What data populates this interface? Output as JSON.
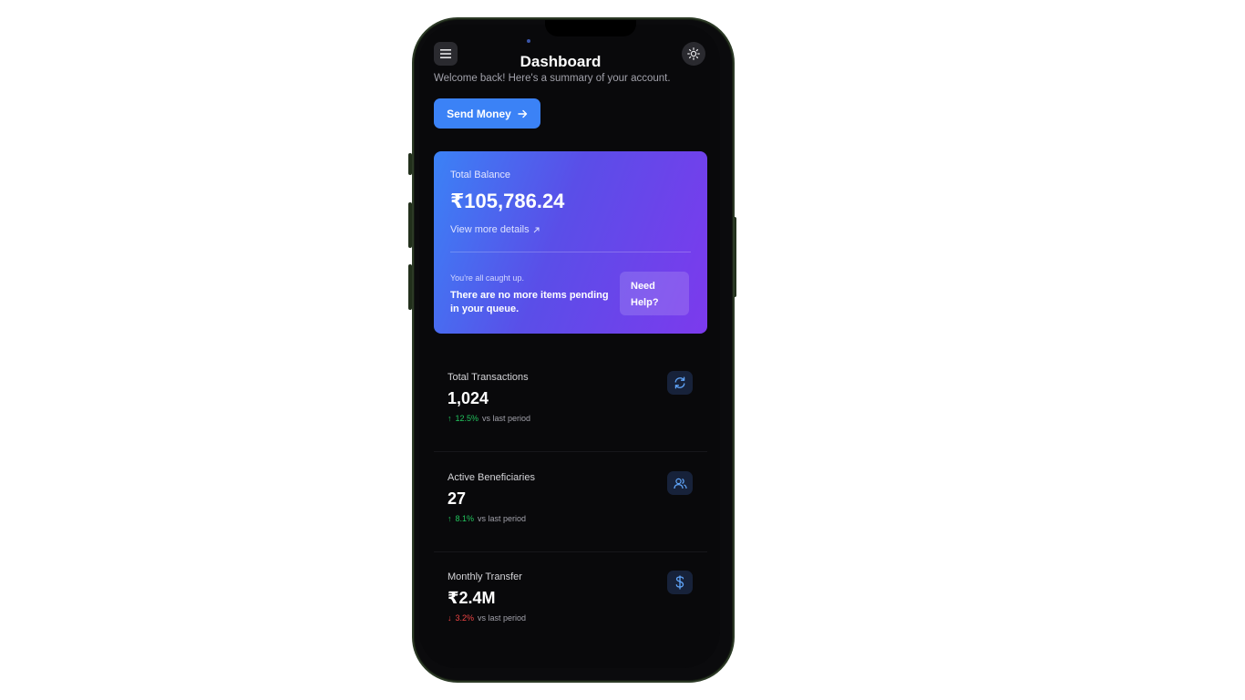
{
  "header": {
    "title": "Dashboard",
    "subtitle": "Welcome back! Here's a summary of your account.",
    "menu_icon": "menu-icon",
    "theme_icon": "sun-icon"
  },
  "actions": {
    "send_money_label": "Send Money"
  },
  "balance_card": {
    "label": "Total Balance",
    "amount": "₹105,786.24",
    "details_link": "View more details",
    "caught_up": "You're all caught up.",
    "message": "There are no more items pending in your queue.",
    "help_label": "Need Help?",
    "gradient": [
      "#3b82f6",
      "#7c3aed"
    ]
  },
  "stats": [
    {
      "label": "Total Transactions",
      "value": "1,024",
      "change": "12.5%",
      "direction": "up",
      "suffix": "vs last period",
      "icon": "refresh-icon"
    },
    {
      "label": "Active Beneficiaries",
      "value": "27",
      "change": "8.1%",
      "direction": "up",
      "suffix": "vs last period",
      "icon": "users-icon"
    },
    {
      "label": "Monthly Transfer",
      "value": "₹2.4M",
      "change": "3.2%",
      "direction": "down",
      "suffix": "vs last period",
      "icon": "dollar-icon"
    }
  ],
  "colors": {
    "accent": "#3b82f6",
    "positive": "#22c55e",
    "negative": "#ef4444",
    "background": "#09090b"
  }
}
